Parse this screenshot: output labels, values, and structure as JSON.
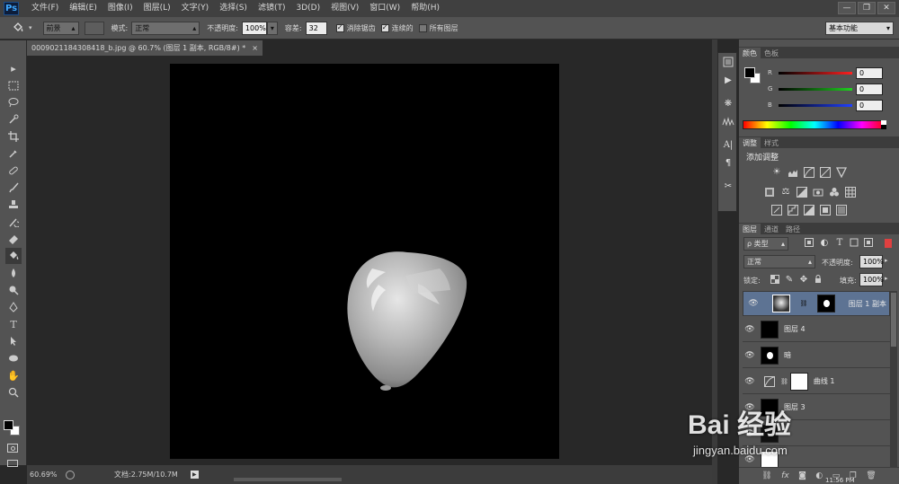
{
  "app": {
    "logo": "Ps"
  },
  "menu": [
    "文件(F)",
    "编辑(E)",
    "图像(I)",
    "图层(L)",
    "文字(Y)",
    "选择(S)",
    "滤镜(T)",
    "3D(D)",
    "视图(V)",
    "窗口(W)",
    "帮助(H)"
  ],
  "window_buttons": [
    "—",
    "❐",
    "✕"
  ],
  "options": {
    "fill_source": "前景",
    "mode_label": "模式:",
    "mode_value": "正常",
    "opacity_label": "不透明度:",
    "opacity_value": "100%",
    "tolerance_label": "容差:",
    "tolerance_value": "32",
    "antialias_label": "消除锯齿",
    "contiguous_label": "连续的",
    "all_layers_label": "所有图层",
    "workspace": "基本功能"
  },
  "document_tab": {
    "title": "0009021184308418_b.jpg @ 60.7% (图层 1 副本, RGB/8#) *",
    "close": "×"
  },
  "status": {
    "zoom": "60.69%",
    "doc_info": "文档:2.75M/10.7M"
  },
  "color_panel": {
    "tabs": [
      "颜色",
      "色板"
    ],
    "channels": [
      {
        "label": "R",
        "value": "0",
        "color": "#ff3030"
      },
      {
        "label": "G",
        "value": "0",
        "color": "#30d030"
      },
      {
        "label": "B",
        "value": "0",
        "color": "#3050ff"
      }
    ]
  },
  "adjust_panel": {
    "tabs": [
      "调整",
      "样式"
    ],
    "title": "添加调整"
  },
  "layers_panel": {
    "tabs": [
      "图层",
      "通道",
      "路径"
    ],
    "filter_label": "ρ 类型",
    "blend_mode": "正常",
    "opacity_label": "不透明度:",
    "opacity_value": "100%",
    "lock_label": "锁定:",
    "fill_label": "填充:",
    "fill_value": "100%",
    "layers": [
      {
        "name": "图层 1 副本",
        "selected": true
      },
      {
        "name": "图层 4",
        "selected": false
      },
      {
        "name": "暗",
        "selected": false
      },
      {
        "name": "曲线 1",
        "selected": false
      },
      {
        "name": "图层 3",
        "selected": false
      },
      {
        "name": "",
        "selected": false
      },
      {
        "name": "",
        "selected": false
      }
    ]
  },
  "watermark": {
    "brand": "Bai 经验",
    "url": "jingyan.baidu.com"
  },
  "clock": "11:56 PM"
}
